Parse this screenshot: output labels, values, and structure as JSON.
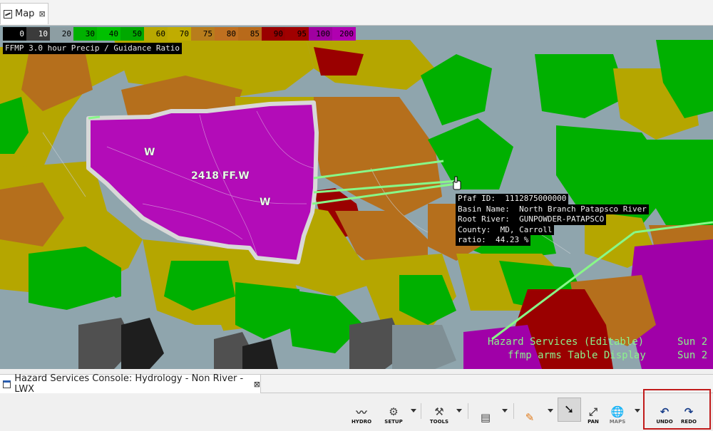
{
  "map_tab": {
    "label": "Map",
    "close": "⊠"
  },
  "legend": {
    "cells": [
      {
        "label": "0",
        "color": "#000000"
      },
      {
        "label": "10",
        "color": "#3b3b3b"
      },
      {
        "label": "20",
        "color": "#8d9ea3"
      },
      {
        "label": "30",
        "color": "#00b000"
      },
      {
        "label": "40",
        "color": "#00c000"
      },
      {
        "label": "50",
        "color": "#00a800"
      },
      {
        "label": "60",
        "color": "#b8a800"
      },
      {
        "label": "70",
        "color": "#c0ac00"
      },
      {
        "label": "75",
        "color": "#b87d1c"
      },
      {
        "label": "80",
        "color": "#c07020"
      },
      {
        "label": "85",
        "color": "#b86a1a"
      },
      {
        "label": "90",
        "color": "#9a0000"
      },
      {
        "label": "95",
        "color": "#a00000"
      },
      {
        "label": "100",
        "color": "#a000a0"
      },
      {
        "label": "200",
        "color": "#b000b0"
      }
    ],
    "caption": "FFMP 3.0 hour Precip / Guidance Ratio"
  },
  "hazard": {
    "label": "2418 FF.W",
    "w1": "W",
    "w2": "W"
  },
  "readout": {
    "rows": [
      "Pfaf ID:  1112875000000",
      "Basin Name:  North Branch Patapsco River",
      "Root River:  GUNPOWDER-PATAPSCO",
      "County:  MD, Carroll",
      "ratio:  44.23 %"
    ]
  },
  "overlay": {
    "line1": "Hazard Services (Editable)",
    "line2": "ffmp arms Table Display",
    "sun1": "Sun 2",
    "sun2": "Sun 2"
  },
  "console_tab": {
    "label": "Hazard Services Console: Hydrology - Non River - LWX",
    "close": "⊠"
  },
  "toolbar": {
    "hydro": "HYDRO",
    "setup": "SETUP",
    "tools": "TOOLS",
    "pan": "PAN",
    "maps": "MAPS",
    "undo": "UNDO",
    "redo": "REDO"
  },
  "colors": {
    "green": "#00b000",
    "olive": "#b5a600",
    "orange": "#b56f1c",
    "darkred": "#9a0000",
    "magenta": "#a000a8",
    "gray": "#8fa5ad",
    "darkgray": "#505050",
    "black": "#1e1e1e",
    "hazard_line": "#88f888"
  }
}
